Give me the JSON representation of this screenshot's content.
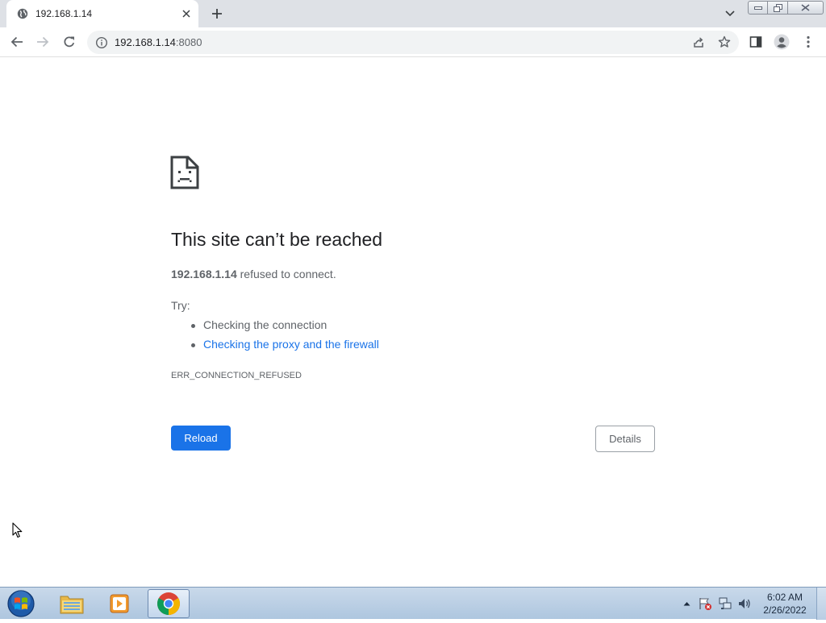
{
  "browser": {
    "tab": {
      "title": "192.168.1.14",
      "favicon": "globe-icon"
    },
    "address": {
      "host": "192.168.1.14",
      "port": ":8080"
    }
  },
  "error_page": {
    "title": "This site can’t be reached",
    "host": "192.168.1.14",
    "message": "refused to connect.",
    "try_label": "Try:",
    "suggestions": [
      {
        "text": "Checking the connection",
        "link": false
      },
      {
        "text": "Checking the proxy and the firewall",
        "link": true
      }
    ],
    "error_code": "ERR_CONNECTION_REFUSED",
    "reload_label": "Reload",
    "details_label": "Details"
  },
  "taskbar": {
    "apps": [
      "windows-explorer",
      "media-player",
      "chrome"
    ],
    "clock": {
      "time": "6:02 AM",
      "date": "2/26/2022"
    }
  },
  "colors": {
    "accent": "#1a73e8",
    "tabstrip": "#dee1e6",
    "text": "#202124",
    "secondary_text": "#5f6368"
  }
}
